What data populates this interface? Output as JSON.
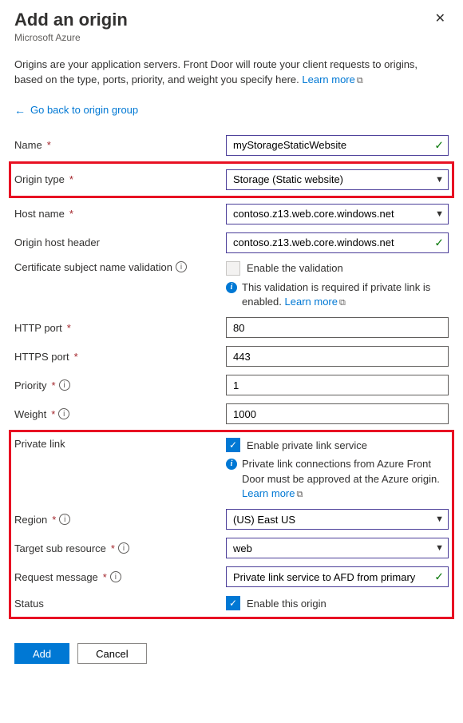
{
  "header": {
    "title": "Add an origin",
    "subtitle": "Microsoft Azure"
  },
  "description": "Origins are your application servers. Front Door will route your client requests to origins, based on the type, ports, priority, and weight you specify here.",
  "learn_more": "Learn more",
  "backlink": "Go back to origin group",
  "labels": {
    "name": "Name",
    "origin_type": "Origin type",
    "host_name": "Host name",
    "origin_host_header": "Origin host header",
    "cert_validation": "Certificate subject name validation",
    "http_port": "HTTP port",
    "https_port": "HTTPS port",
    "priority": "Priority",
    "weight": "Weight",
    "private_link": "Private link",
    "region": "Region",
    "target_sub": "Target sub resource",
    "request_msg": "Request message",
    "status": "Status"
  },
  "values": {
    "name": "myStorageStaticWebsite",
    "origin_type": "Storage (Static website)",
    "host_name": "contoso.z13.web.core.windows.net",
    "origin_host_header": "contoso.z13.web.core.windows.net",
    "enable_validation": "Enable the validation",
    "validation_msg": "This validation is required if private link is enabled.",
    "http_port": "80",
    "https_port": "443",
    "priority": "1",
    "weight": "1000",
    "enable_pl": "Enable private link service",
    "pl_msg": "Private link connections from Azure Front Door must be approved at the Azure origin.",
    "region": "(US) East US",
    "target_sub": "web",
    "request_msg": "Private link service to AFD from primary",
    "enable_origin": "Enable this origin"
  },
  "footer": {
    "add": "Add",
    "cancel": "Cancel"
  }
}
